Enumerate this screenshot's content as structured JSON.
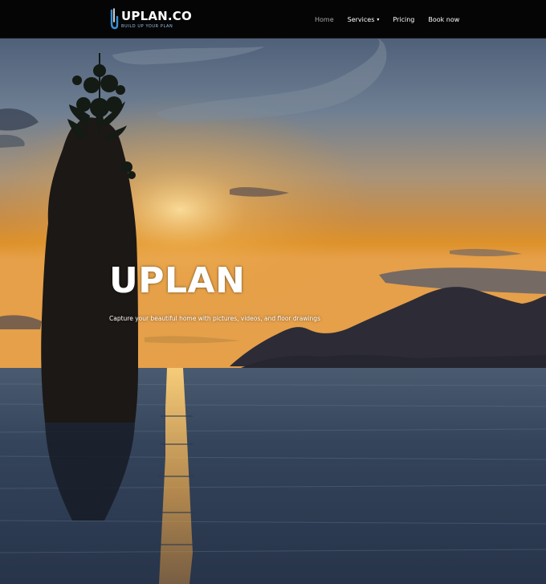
{
  "brand": {
    "name": "UPLAN.CO",
    "tagline": "BUILD UP YOUR PLAN",
    "logo_icon": "u-logo-icon",
    "accent_color": "#3a8fd6"
  },
  "nav": {
    "items": [
      {
        "label": "Home",
        "active": true
      },
      {
        "label": "Services",
        "caret": "▾"
      },
      {
        "label": "Pricing"
      },
      {
        "label": "Book now"
      }
    ]
  },
  "hero": {
    "title": "UPLAN",
    "subtitle": "Capture your beautiful home with pictures, videos, and floor drawings",
    "background": "sunset-sea-stack-photo"
  },
  "colors": {
    "navbar_bg": "#050505",
    "nav_text": "#ffffff",
    "nav_active": "#a7a7a7",
    "sky_top": "#5a6b85",
    "sky_horizon": "#d9902c",
    "water": "#2c3a4f"
  }
}
